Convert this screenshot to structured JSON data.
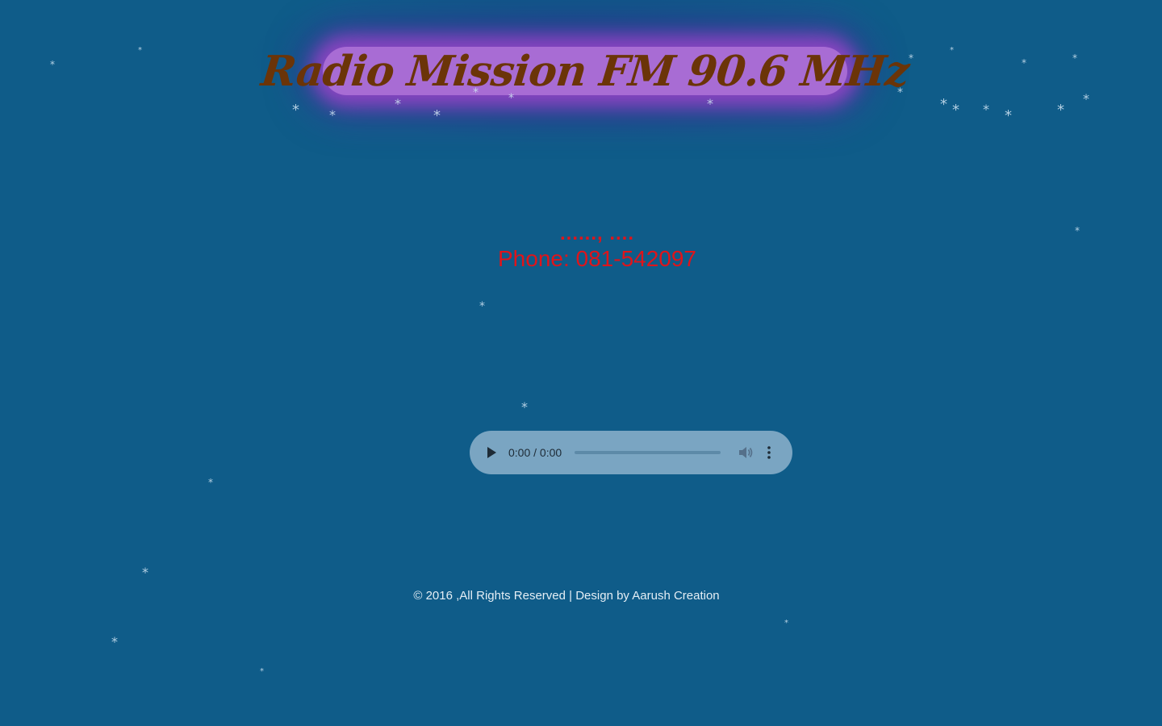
{
  "header": {
    "title": "Radio Mission FM 90.6 MHz"
  },
  "contact": {
    "address": "......, ....",
    "phone": "Phone: 081-542097"
  },
  "player": {
    "time_display": "0:00 / 0:00",
    "progress_fraction": 0,
    "play_icon": "play-icon",
    "volume_icon": "volume-icon",
    "menu_icon": "more-vertical-icon"
  },
  "footer": {
    "text": "© 2016 ,All Rights Reserved | Design by Aarush Creation"
  },
  "snowflake_glyph": "*"
}
